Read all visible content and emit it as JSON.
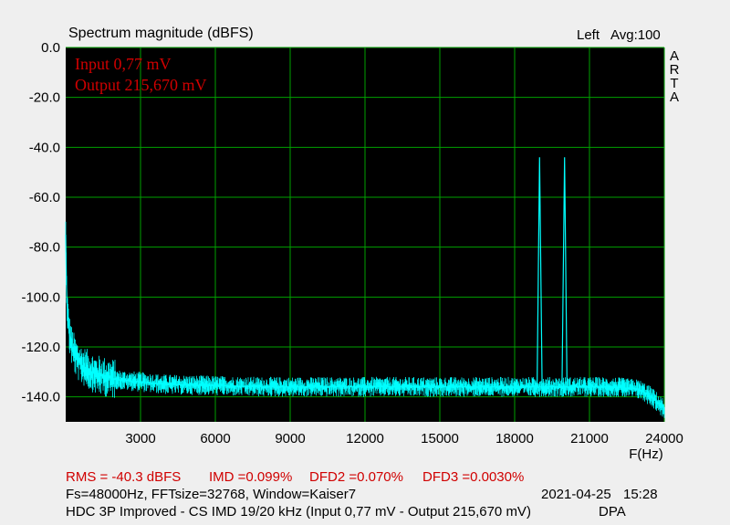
{
  "header": {
    "title": "Spectrum magnitude (dBFS)",
    "channel": "Left",
    "averaging": "Avg:100",
    "side_letters": [
      "A",
      "R",
      "T",
      "A"
    ]
  },
  "footer": {
    "rms": "RMS =  -40.3 dBFS",
    "imd": "IMD =0.099%",
    "dfd2": "DFD2 =0.070%",
    "dfd3": "DFD3 =0.0030%",
    "settings": "Fs=48000Hz, FFTsize=32768, Window=Kaiser7",
    "date": "2021-04-25",
    "time": "15:28",
    "description": "HDC 3P Improved - CS IMD 19/20 kHz (Input 0,77 mV - Output 215,670 mV)",
    "brand": "DPA"
  },
  "colors": {
    "plot_background": "#000000",
    "grid": "#00a000",
    "trace": "#00ffff",
    "annotation": "#d00000",
    "page_background": "#efefef"
  },
  "chart_data": {
    "type": "line",
    "title": "Spectrum magnitude (dBFS)",
    "xlabel": "F(Hz)",
    "ylabel": "",
    "xlim": [
      0,
      24000
    ],
    "ylim": [
      -150,
      0
    ],
    "xticks": [
      "3000",
      "6000",
      "9000",
      "12000",
      "15000",
      "18000",
      "21000",
      "24000"
    ],
    "yticks": [
      "0.0",
      "-20.0",
      "-40.0",
      "-60.0",
      "-80.0",
      "-100.0",
      "-120.0",
      "-140.0"
    ],
    "grid": true,
    "annotations": [
      "Input 0,77 mV",
      "Output 215,670 mV"
    ],
    "series": [
      {
        "x": [
          0,
          30,
          60,
          100,
          150,
          250,
          400,
          600,
          900,
          1200,
          1600,
          2000,
          3000,
          4000,
          6000,
          8000,
          10000,
          12000,
          14000,
          16000,
          18000,
          18900,
          19000,
          19100,
          19900,
          20000,
          20100,
          21000,
          22000,
          23000,
          23500,
          24000
        ],
        "y": [
          -75,
          -95,
          -104,
          -110,
          -115,
          -120,
          -124,
          -127,
          -129,
          -131,
          -132,
          -133,
          -134,
          -135,
          -135.5,
          -136,
          -136,
          -136,
          -136,
          -136,
          -136,
          -136,
          -44,
          -136,
          -136,
          -44,
          -136,
          -136,
          -136,
          -137,
          -140,
          -145
        ]
      }
    ]
  }
}
